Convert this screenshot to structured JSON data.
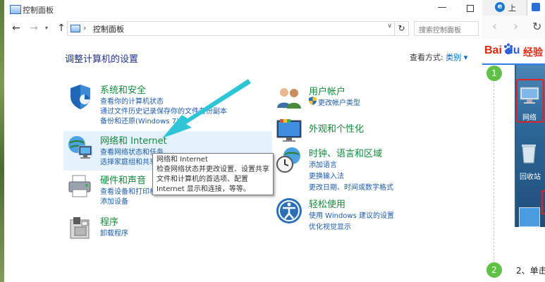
{
  "window": {
    "title": "控制面板",
    "minimize_glyph": "—"
  },
  "nav": {
    "back": "←",
    "forward": "→",
    "recent": "▾",
    "up": "↑",
    "address_sep": "›",
    "address_text": "控制面板",
    "address_drop": "∨",
    "refresh": "↻",
    "search_placeholder": "搜索控制面板"
  },
  "content": {
    "heading": "调整计算机的设置",
    "view_by_label": "查看方式:",
    "view_by_value": "类别 ▾",
    "categories_left": [
      {
        "icon": "shield-icon",
        "title": "系统和安全",
        "links": [
          "查看你的计算机状态",
          "通过文件历史记录保存你的文件备份副本",
          "备份和还原(Windows 7)"
        ]
      },
      {
        "icon": "network-icon",
        "title": "网络和 Internet",
        "links": [
          "查看网络状态和任务",
          "选择家庭组和共享选项"
        ]
      },
      {
        "icon": "printer-icon",
        "title": "硬件和声音",
        "links": [
          "查看设备和打印机",
          "添加设备"
        ]
      },
      {
        "icon": "programs-icon",
        "title": "程序",
        "links": [
          "卸载程序"
        ]
      }
    ],
    "categories_right": [
      {
        "icon": "users-icon",
        "title": "用户帐户",
        "links": [
          "更改帐户类型"
        ]
      },
      {
        "icon": "appearance-icon",
        "title": "外观和个性化",
        "links": []
      },
      {
        "icon": "clock-globe-icon",
        "title": "时钟、语言和区域",
        "links": [
          "添加语言",
          "更换输入法",
          "更改日期、时间或数字格式"
        ]
      },
      {
        "icon": "ease-of-access-icon",
        "title": "轻松使用",
        "links": [
          "使用 Windows 建议的设置",
          "优化视觉显示"
        ]
      }
    ],
    "tooltip": [
      "网络和 Internet",
      "检查网络状态并更改设置、设置共享",
      "文件和计算机的首选项、配置",
      "Internet 显示和连接，等等。"
    ]
  },
  "browser": {
    "tab_icon": "e",
    "tab_label": "上",
    "back": "‹",
    "forward": "›",
    "reload": "↻",
    "logo_bai": "Bai",
    "logo_du": "du",
    "logo_jingyan": "经验",
    "step1": "1",
    "step2": "2",
    "step2_text": "2、单击",
    "network_label": "网络",
    "recycle_label": "回收站"
  },
  "colors": {
    "category_title": "#138a3a",
    "link": "#1c5caa",
    "heading": "#1e3287",
    "highlight": "#e5f1fb",
    "arrow": "#2ec6d6",
    "step_badge": "#5fc247"
  }
}
